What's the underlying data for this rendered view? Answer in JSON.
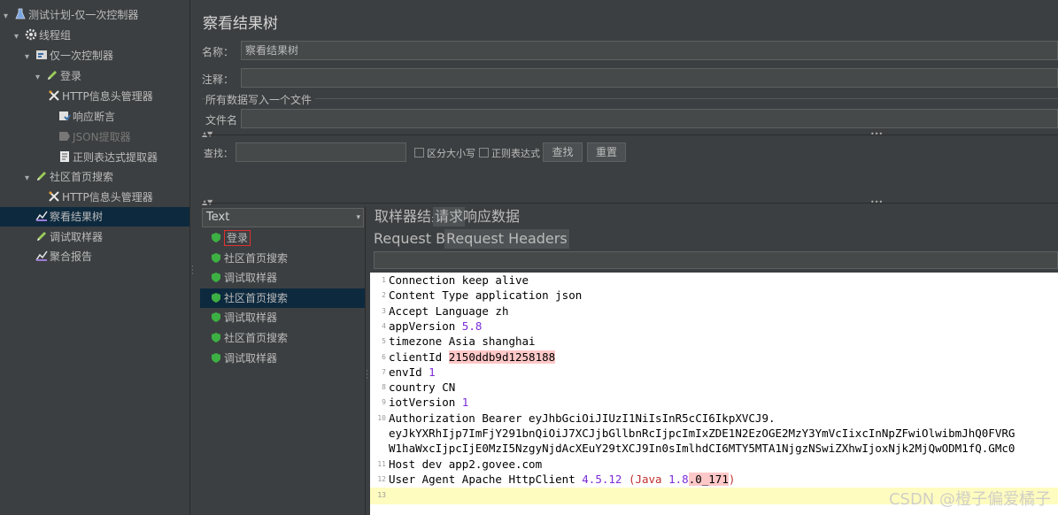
{
  "tree": {
    "items": [
      {
        "label": "测试计划-仅一次控制器",
        "icon": "flask-icon",
        "twisty": "▾"
      },
      {
        "label": "线程组",
        "icon": "gear-icon",
        "twisty": "▾"
      },
      {
        "label": "仅一次控制器",
        "icon": "controller-icon",
        "twisty": "▾"
      },
      {
        "label": "登录",
        "icon": "pencil-icon",
        "twisty": "▾"
      },
      {
        "label": "HTTP信息头管理器",
        "icon": "wrench-icon",
        "twisty": ""
      },
      {
        "label": "响应断言",
        "icon": "assertion-icon",
        "twisty": ""
      },
      {
        "label": "JSON提取器",
        "icon": "extractor-icon",
        "twisty": ""
      },
      {
        "label": "正则表达式提取器",
        "icon": "document-icon",
        "twisty": ""
      },
      {
        "label": "社区首页搜索",
        "icon": "pencil-icon",
        "twisty": "▾"
      },
      {
        "label": "HTTP信息头管理器",
        "icon": "wrench-icon",
        "twisty": ""
      },
      {
        "label": "察看结果树",
        "icon": "chart-icon",
        "twisty": ""
      },
      {
        "label": "调试取样器",
        "icon": "pencil-icon",
        "twisty": ""
      },
      {
        "label": "聚合报告",
        "icon": "chart-icon",
        "twisty": ""
      }
    ]
  },
  "main": {
    "title": "察看结果树",
    "name_label": "名称：",
    "name_value": "察看结果树",
    "comment_label": "注释：",
    "comment_value": "",
    "file_section": "所有数据写入一个文件",
    "filename_label": "文件名",
    "filename_value": "",
    "search_label": "查找：",
    "search_value": "",
    "case_label": "区分大小写",
    "regex_label": "正则表达式",
    "find_button": "查找",
    "reset_button": "重置",
    "splitter_arrows": "▲▼",
    "splitter_dots": "•••"
  },
  "results": {
    "renderer": "Text",
    "items": [
      "登录",
      "社区首页搜索",
      "调试取样器",
      "社区首页搜索",
      "调试取样器",
      "社区首页搜索",
      "调试取样器"
    ]
  },
  "detail": {
    "tabs": [
      "取样器结果",
      "请求",
      "响应数据"
    ],
    "subtabs": [
      "Request Body",
      "Request Headers"
    ]
  },
  "code": {
    "nums": [
      "1",
      "2",
      "3",
      "4",
      "5",
      "6",
      "7",
      "8",
      "9",
      "10",
      "",
      "11",
      "12",
      "13"
    ],
    "l1": {
      "k": "Connection",
      "v": "keep alive"
    },
    "l2": {
      "k": "Content Type",
      "v": "application json"
    },
    "l3": {
      "k": "Accept Language",
      "v": "zh"
    },
    "l4": {
      "k": "appVersion",
      "v": "5.8"
    },
    "l5": {
      "k": "timezone",
      "v": "Asia shanghai"
    },
    "l6": {
      "k": "clientId",
      "v": "2150ddb9d1258188"
    },
    "l7": {
      "k": "envId",
      "v": "1"
    },
    "l8": {
      "k": "country",
      "v": "CN"
    },
    "l9": {
      "k": "iotVersion",
      "v": "1"
    },
    "l10": {
      "k": "Authorization",
      "v": "Bearer eyJhbGciOiJIUzI1NiIsInR5cCI6IkpXVCJ9."
    },
    "l10b": "eyJkYXRhIjp7ImFjY291bnQiOiJ7XCJjbGllbnRcIjpcImIxZDE1N2EzOGE2MzY3YmVcIixcInNpZFwiOlwibmJhQ0FVRG",
    "l10c": "W1haWxcIjpcIjE0MzI5NzgyNjdAcXEuY29tXCJ9In0sImlhdCI6MTY5MTA1NjgzNSwiZXhwIjoxNjk2MjQwODM1fQ.GMc0",
    "l11": {
      "k": "Host",
      "v": "dev app2.govee.com"
    },
    "l12": {
      "k": "User Agent",
      "v1": "Apache HttpClient",
      "v2": "4.5.12",
      "v3": "(Java",
      "v4": "1.8",
      "v5": ".0_171",
      "v6": ")"
    }
  },
  "watermark": "CSDN @橙子偏爱橘子",
  "colors": {
    "panel": "#3c3f41",
    "selection": "#0d293e",
    "highlight": "#ffc8c8",
    "current_line": "#fffcbf"
  }
}
